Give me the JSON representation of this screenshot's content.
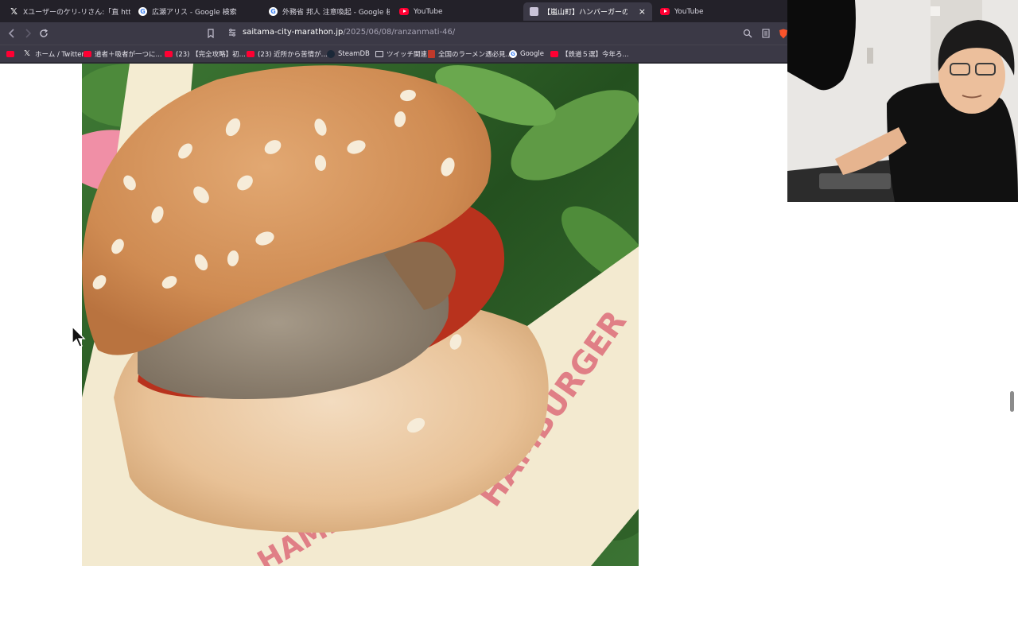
{
  "tabs": [
    {
      "label": "Xユーザーのケリ-リさん:「直 https://t.co/...",
      "icon": "x-icon"
    },
    {
      "label": "広瀬アリス - Google 検索",
      "icon": "google-icon"
    },
    {
      "label": "外務省 邦人 注意喚起 - Google 検索",
      "icon": "google-icon"
    },
    {
      "label": "YouTube",
      "icon": "youtube-icon"
    },
    {
      "label": "【嵐山町】ハンバーガーの自販機を発",
      "icon": "page-icon",
      "active": true,
      "close": "×"
    },
    {
      "label": "YouTube",
      "icon": "youtube-icon"
    }
  ],
  "address_bar": {
    "domain": "saitama-city-marathon.jp",
    "path": "/2025/06/08/ranzanmati-46/"
  },
  "bookmarks": [
    {
      "label": "ホーム / Twitter",
      "icon": "x-icon"
    },
    {
      "label": "道者＋吸者が一つに...",
      "icon": "youtube-icon"
    },
    {
      "label": "(23) 【完全攻略】初...",
      "icon": "youtube-icon"
    },
    {
      "label": "(23) 近所から苦情が...",
      "icon": "youtube-icon"
    },
    {
      "label": "SteamDB",
      "icon": "steam-icon"
    },
    {
      "label": "ツイッチ関連",
      "icon": "folder-icon"
    },
    {
      "label": "全国のラーメン遇必見...",
      "icon": "ramen-icon"
    },
    {
      "label": "Google",
      "icon": "google-icon"
    },
    {
      "label": "【鉄道５選】今年ろ...",
      "icon": "youtube-icon"
    }
  ],
  "page": {
    "image_alt": "hamburger photo",
    "wrapper_text": "HAMBURGER"
  },
  "colors": {
    "browser_bg": "#2b2a33",
    "tabbar_bg": "#232129",
    "bun": "#d99a5e",
    "patty": "#8f8271",
    "sauce": "#b8321d",
    "wrapper": "#f3ead0",
    "wrapper_print": "#e07f86",
    "leaves": "#2d5a2a"
  }
}
